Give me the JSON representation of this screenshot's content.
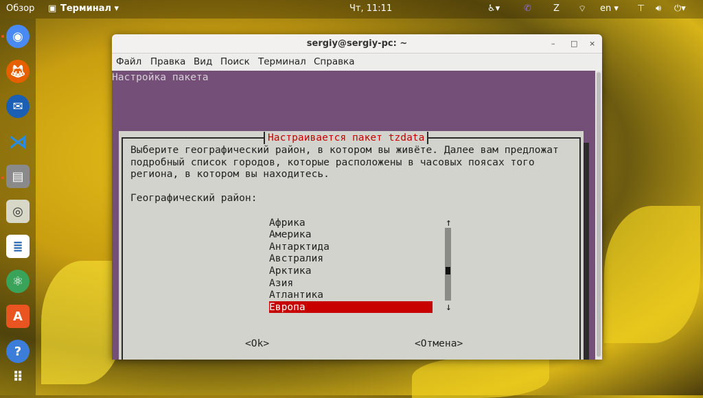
{
  "topbar": {
    "activities": "Обзор",
    "app_menu": "Терминал ▾",
    "clock": "Чт, 11:11",
    "lang": "en ▾",
    "icons": [
      "accessibility-icon",
      "viber-icon",
      "zotero-icon",
      "network-wifi-icon",
      "network-wired-icon",
      "volume-icon",
      "power-icon"
    ]
  },
  "dock": {
    "apps": [
      "chromium",
      "firefox",
      "thunderbird",
      "vscode",
      "files",
      "rhythmbox",
      "libreoffice-writer",
      "atom",
      "software-center",
      "help",
      "show-applications"
    ]
  },
  "window": {
    "title": "sergiy@sergiy-pc: ~",
    "menu": [
      "Файл",
      "Правка",
      "Вид",
      "Поиск",
      "Терминал",
      "Справка"
    ]
  },
  "terminal": {
    "header": "Настройка пакета",
    "dialog": {
      "title": "Настраивается пакет tzdata",
      "text": [
        "Выберите географический район, в котором вы живёте. Далее вам предложат",
        "подробный список городов, которые расположены в часовых поясах того",
        "региона, в котором вы находитесь."
      ],
      "label": "Географический район:",
      "options": [
        "Африка",
        "Америка",
        "Антарктида",
        "Австралия",
        "Арктика",
        "Азия",
        "Атлантика",
        "Европа"
      ],
      "selected": "Европа",
      "scroll_up": "↑",
      "scroll_down": "↓",
      "ok": "<Ok>",
      "cancel": "<Отмена>"
    }
  },
  "colors": {
    "terminal_bg": "#744f78",
    "dialog_bg": "#d3d3cd",
    "accent_red": "#c80000"
  }
}
